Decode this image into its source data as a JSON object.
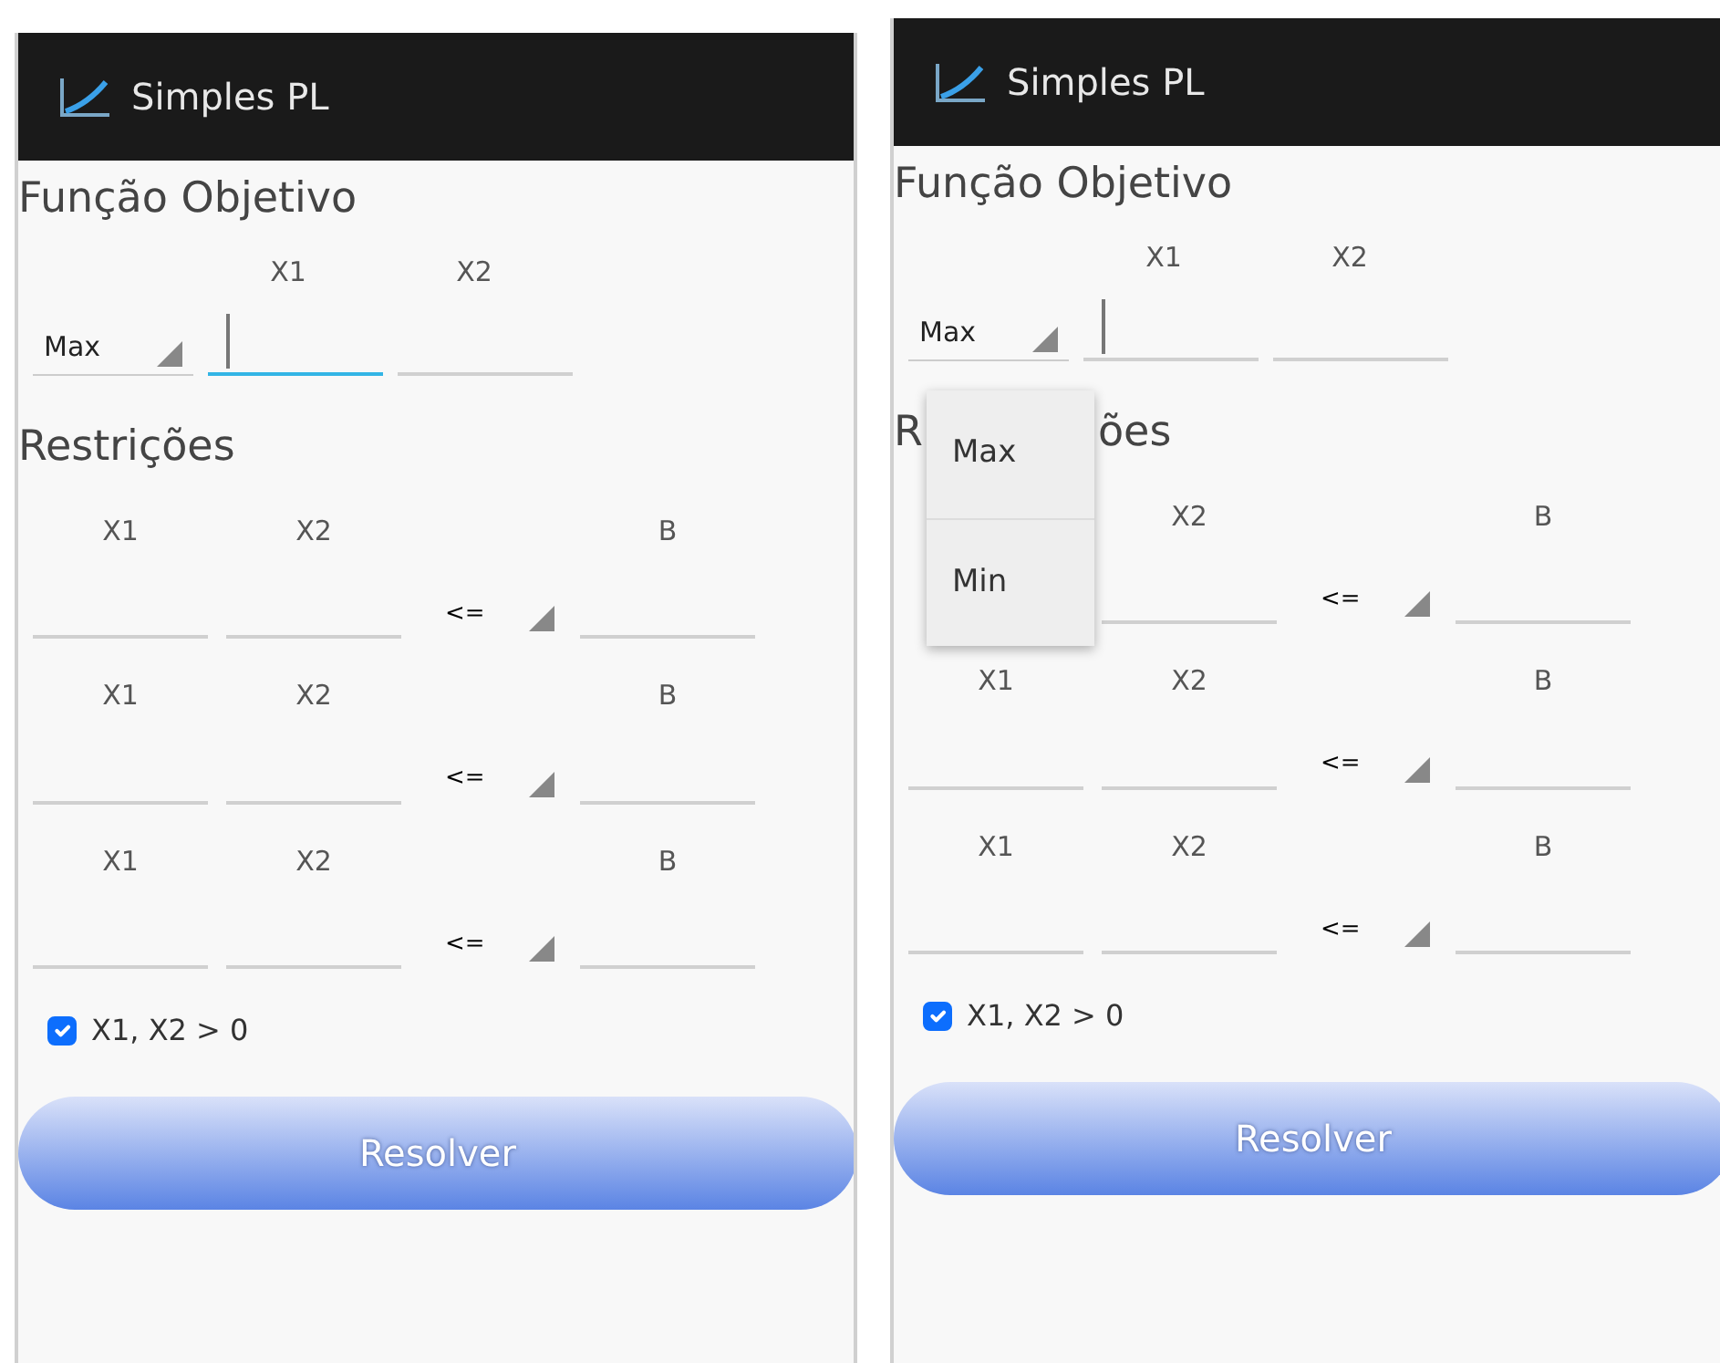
{
  "phones": [
    {
      "app_title": "Simples PL",
      "objective_title": "Função Objetivo",
      "objective": {
        "mode": "Max",
        "variables": [
          {
            "label": "X1",
            "focused": true,
            "cursor": true
          },
          {
            "label": "X2",
            "focused": false,
            "cursor": false
          }
        ]
      },
      "constraints_title_parts": [
        "Restrições"
      ],
      "constraints": [
        {
          "x1_label": "X1",
          "x2_label": "X2",
          "b_label": "B",
          "operator": "<="
        },
        {
          "x1_label": "X1",
          "x2_label": "X2",
          "b_label": "B",
          "operator": "<="
        },
        {
          "x1_label": "X1",
          "x2_label": "X2",
          "b_label": "B",
          "operator": "<="
        }
      ],
      "nonnegative": {
        "label": "X1, X2 > 0",
        "checked": true
      },
      "solve_button": {
        "label": "Resolver",
        "disabled": true
      }
    },
    {
      "app_title": "Simples PL",
      "objective_title": "Função Objetivo",
      "objective": {
        "mode": "Max",
        "variables": [
          {
            "label": "X1",
            "focused": false,
            "cursor": true
          },
          {
            "label": "X2",
            "focused": false,
            "cursor": false
          }
        ]
      },
      "constraints_title_parts": [
        "R",
        "ões"
      ],
      "constraints": [
        {
          "x2_label": "X2",
          "b_label": "B",
          "operator": "<="
        },
        {
          "x1_label": "X1",
          "x2_label": "X2",
          "b_label": "B",
          "operator": "<="
        },
        {
          "x1_label": "X1",
          "x2_label": "X2",
          "b_label": "B",
          "operator": "<="
        }
      ],
      "nonnegative": {
        "label": "X1, X2 > 0",
        "checked": true
      },
      "solve_button": {
        "label": "Resolver",
        "disabled": true
      },
      "dropdown_menu": {
        "options": [
          {
            "label": "Max",
            "selected": false
          },
          {
            "label": "Min",
            "selected": false
          }
        ]
      }
    }
  ]
}
